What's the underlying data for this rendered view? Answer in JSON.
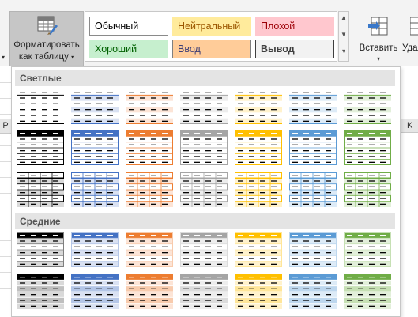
{
  "ribbon": {
    "format_button": {
      "line1": "Форматировать",
      "line2": "как таблицу",
      "caret": "▾"
    },
    "insert_button": {
      "label": "Вставить",
      "caret": "▾"
    },
    "delete_button": {
      "label": "Удалить"
    },
    "cell_styles": [
      {
        "label": "Обычный",
        "bg": "#ffffff",
        "fg": "#000000",
        "border": "#8a8a8a",
        "bold": false
      },
      {
        "label": "Нейтральный",
        "bg": "#ffeb9c",
        "fg": "#9c5700",
        "border": "#ffeb9c",
        "bold": false
      },
      {
        "label": "Плохой",
        "bg": "#ffc7ce",
        "fg": "#9c0006",
        "border": "#ffc7ce",
        "bold": false
      },
      {
        "label": "Хороший",
        "bg": "#c6efce",
        "fg": "#006100",
        "border": "#c6efce",
        "bold": false
      },
      {
        "label": "Ввод",
        "bg": "#ffcc99",
        "fg": "#3f3f76",
        "border": "#7f7f7f",
        "bold": false
      },
      {
        "label": "Вывод",
        "bg": "#f2f2f2",
        "fg": "#3f3f3f",
        "border": "#3f3f3f",
        "bold": true
      }
    ]
  },
  "sheet": {
    "col_left": "P",
    "col_right": "K"
  },
  "gallery": {
    "sections": [
      {
        "title": "Светлые"
      },
      {
        "title": "Средние"
      }
    ],
    "colors": [
      "#000000",
      "#4472c4",
      "#ed7d31",
      "#a5a5a5",
      "#ffc000",
      "#5b9bd5",
      "#70ad47"
    ],
    "light_tints": [
      "#d9d9d9",
      "#d9e1f2",
      "#fce4d6",
      "#ededed",
      "#fff2cc",
      "#ddebf7",
      "#e2efda"
    ],
    "medium_tints": [
      "#bfbfbf",
      "#b4c6e7",
      "#f8cbad",
      "#dbdbdb",
      "#ffe699",
      "#bdd7ee",
      "#c6e0b4"
    ]
  }
}
